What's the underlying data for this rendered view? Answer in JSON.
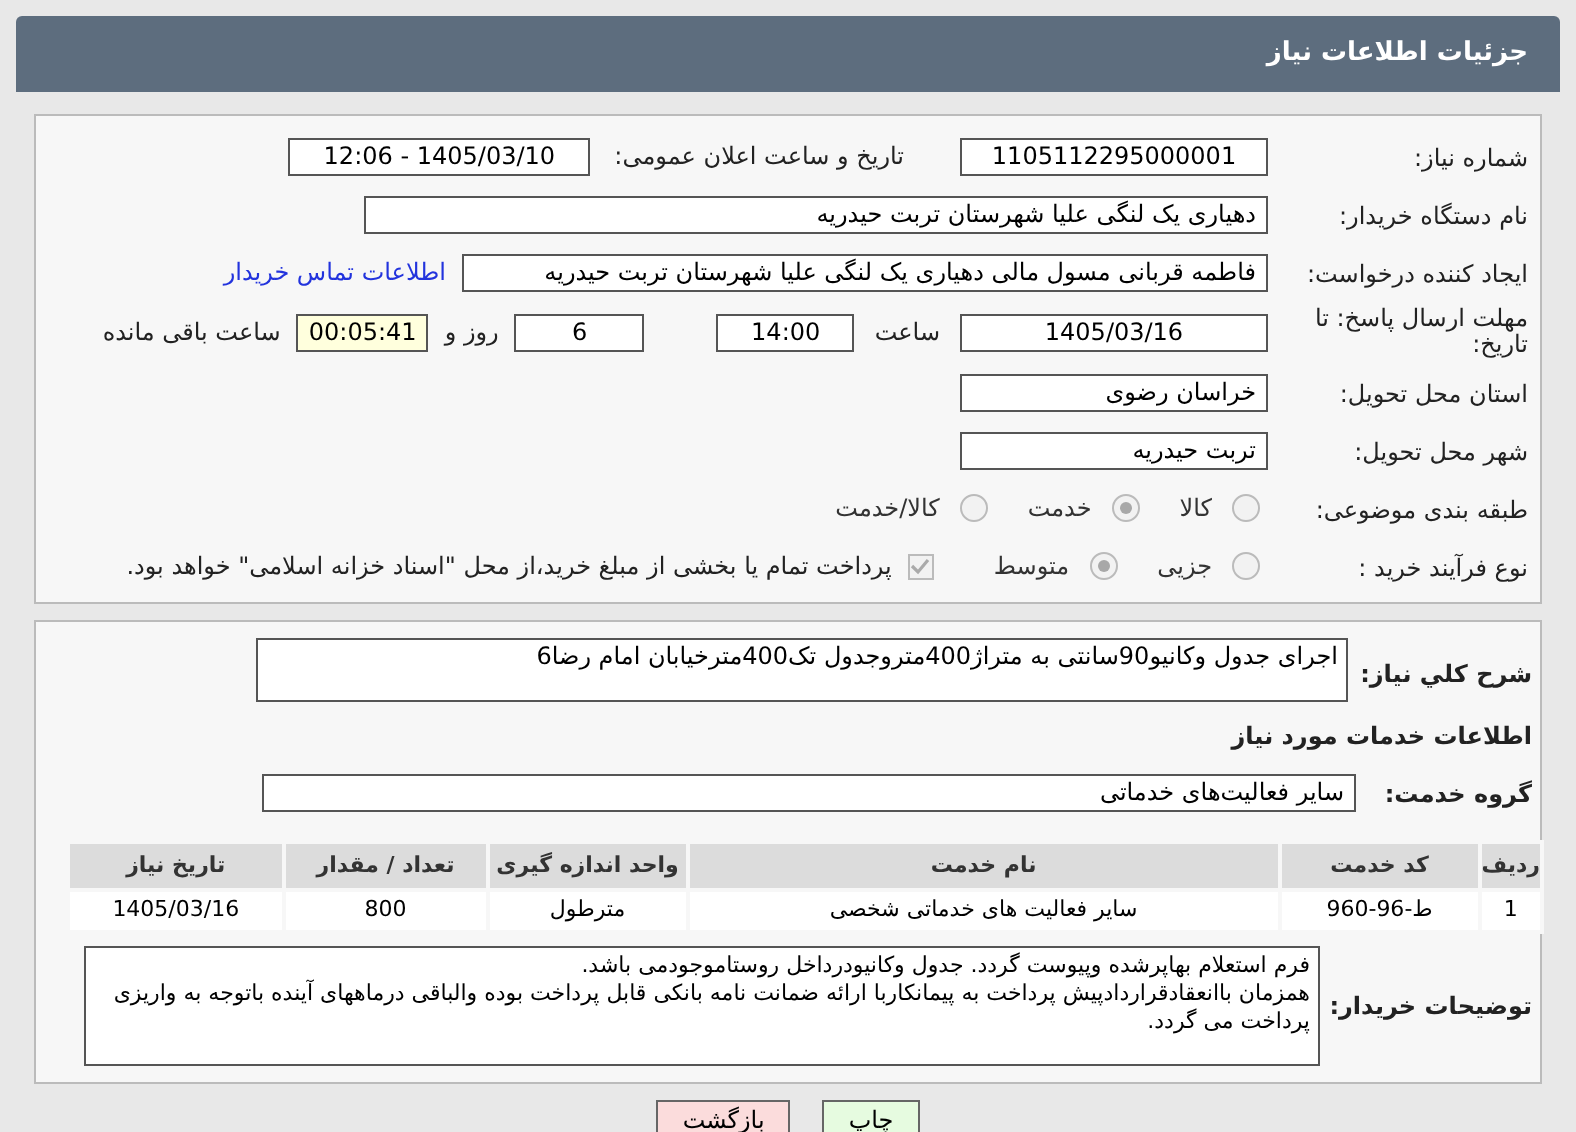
{
  "header": {
    "title": "جزئیات اطلاعات نیاز"
  },
  "need_number": {
    "label": "شماره نیاز:",
    "value": "1105112295000001"
  },
  "announce": {
    "label": "تاریخ و ساعت اعلان عمومی:",
    "value": "1405/03/10 - 12:06"
  },
  "buyer": {
    "label": "نام دستگاه خریدار:",
    "value": "دهیاری یک لنگی علیا  شهرستان تربت حیدریه"
  },
  "creator": {
    "label": "ایجاد کننده درخواست:",
    "value": "فاطمه قربانی مسول مالی دهیاری یک لنگی علیا  شهرستان تربت حیدریه",
    "link": "اطلاعات تماس خریدار"
  },
  "deadline": {
    "label": "مهلت ارسال پاسخ: تا تاریخ:",
    "date": "1405/03/16",
    "time_label": "ساعت",
    "time": "14:00",
    "days": "6",
    "days_label": "روز و",
    "remaining": "00:05:41",
    "remaining_label": "ساعت باقی مانده"
  },
  "province": {
    "label": "استان محل تحویل:",
    "value": "خراسان رضوی"
  },
  "city": {
    "label": "شهر محل تحویل:",
    "value": "تربت حیدریه"
  },
  "category": {
    "label": "طبقه بندی موضوعی:",
    "options": [
      {
        "label": "کالا",
        "selected": false
      },
      {
        "label": "خدمت",
        "selected": true
      },
      {
        "label": "کالا/خدمت",
        "selected": false
      }
    ]
  },
  "process": {
    "label": "نوع فرآیند خرید :",
    "options": [
      {
        "label": "جزیی",
        "selected": false
      },
      {
        "label": "متوسط",
        "selected": true
      }
    ],
    "treasury": {
      "label": "پرداخت تمام یا بخشی از مبلغ خرید،از محل \"اسناد خزانه اسلامی\" خواهد بود.",
      "checked": true
    }
  },
  "description": {
    "label": "شرح كلي نياز:",
    "value": "اجرای جدول وکانیو90سانتی به متراژ400متروجدول تک400مترخیابان امام رضا6"
  },
  "services_heading": "اطلاعات خدمات مورد نیاز",
  "service_group": {
    "label": "گروه خدمت:",
    "value": "سایر فعالیت‌های خدماتی"
  },
  "table": {
    "columns": [
      "ردیف",
      "کد خدمت",
      "نام خدمت",
      "واحد اندازه گیری",
      "تعداد / مقدار",
      "تاریخ نیاز"
    ],
    "rows": [
      [
        "1",
        "ط-96-960",
        "سایر فعالیت های خدماتی شخصی",
        "مترطول",
        "800",
        "1405/03/16"
      ]
    ]
  },
  "buyer_notes": {
    "label": "توضیحات خریدار:",
    "lines": [
      "فرم استعلام بهاپرشده وپیوست گردد. جدول وکانیودرداخل روستاموجودمی باشد.",
      "همزمان باانعقادقراردادپیش پرداخت به پیمانکاربا ارائه ضمانت نامه بانکی قابل پرداخت بوده والباقی درماههای آینده باتوجه به واریزی پرداخت می گردد."
    ]
  },
  "buttons": [
    {
      "label": "چاپ",
      "kind": "print"
    },
    {
      "label": "بازگشت",
      "kind": "back"
    }
  ]
}
